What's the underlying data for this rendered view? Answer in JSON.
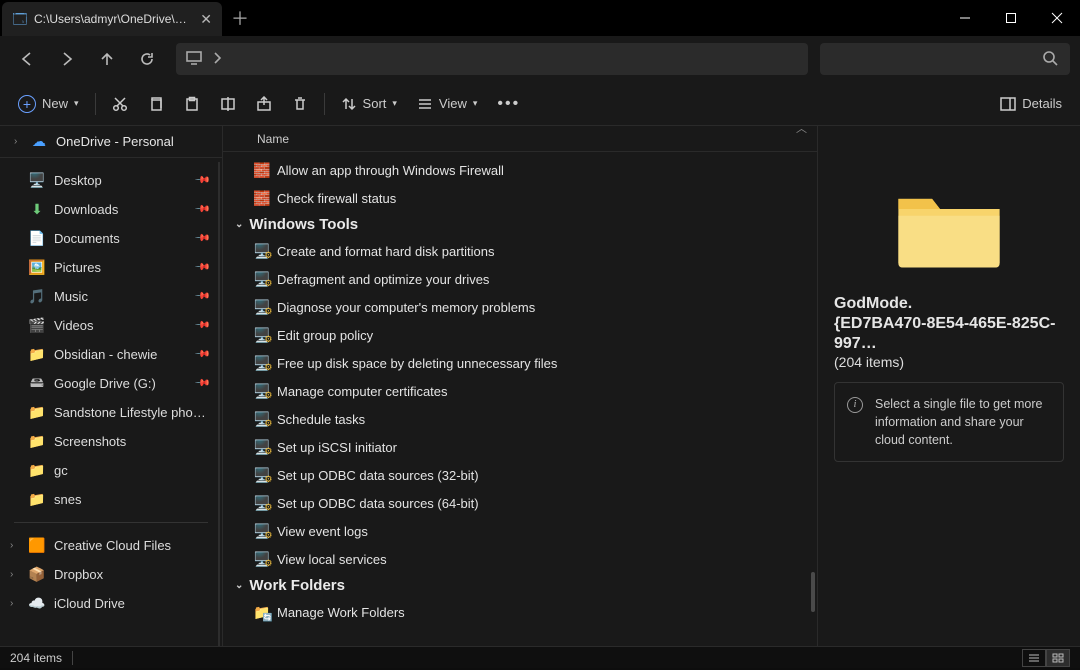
{
  "tab": {
    "title": "C:\\Users\\admyr\\OneDrive\\Des"
  },
  "toolbar": {
    "new": "New",
    "sort": "Sort",
    "view": "View",
    "details": "Details"
  },
  "onedrive_header": "OneDrive - Personal",
  "sidebar": [
    {
      "icon": "🖥️",
      "cls": "i-desktop",
      "label": "Desktop",
      "pinned": true
    },
    {
      "icon": "⬇",
      "cls": "i-download",
      "label": "Downloads",
      "pinned": true
    },
    {
      "icon": "📄",
      "cls": "i-doc",
      "label": "Documents",
      "pinned": true
    },
    {
      "icon": "🖼️",
      "cls": "i-pic",
      "label": "Pictures",
      "pinned": true
    },
    {
      "icon": "🎵",
      "cls": "i-music",
      "label": "Music",
      "pinned": true
    },
    {
      "icon": "🎬",
      "cls": "i-video",
      "label": "Videos",
      "pinned": true
    },
    {
      "icon": "📁",
      "cls": "i-folder",
      "label": "Obsidian - chewie",
      "pinned": true
    },
    {
      "icon": "🖴",
      "cls": "i-drive",
      "label": "Google Drive (G:)",
      "pinned": true
    },
    {
      "icon": "📁",
      "cls": "i-folder",
      "label": "Sandstone Lifestyle photos",
      "pinned": false
    },
    {
      "icon": "📁",
      "cls": "i-folder",
      "label": "Screenshots",
      "pinned": false
    },
    {
      "icon": "📁",
      "cls": "i-folder",
      "label": "gc",
      "pinned": false
    },
    {
      "icon": "📁",
      "cls": "i-folder",
      "label": "snes",
      "pinned": false
    }
  ],
  "sidebar_bottom": [
    {
      "icon": "🟧",
      "label": "Creative Cloud Files"
    },
    {
      "icon": "📦",
      "label": "Dropbox",
      "iconColor": "#2f7dff"
    },
    {
      "icon": "☁️",
      "label": "iCloud Drive",
      "iconColor": "#3fbcf5"
    }
  ],
  "header_col": "Name",
  "firewall_items": [
    "Allow an app through Windows Firewall",
    "Check firewall status"
  ],
  "groups": [
    {
      "title": "Windows Tools",
      "iconClass": "i-tool",
      "iconGlyph": "🖥️",
      "items": [
        "Create and format hard disk partitions",
        "Defragment and optimize your drives",
        "Diagnose your computer's memory problems",
        "Edit group policy",
        "Free up disk space by deleting unnecessary files",
        "Manage computer certificates",
        "Schedule tasks",
        "Set up iSCSI initiator",
        "Set up ODBC data sources (32-bit)",
        "Set up ODBC data sources (64-bit)",
        "View event logs",
        "View local services"
      ]
    },
    {
      "title": "Work Folders",
      "iconClass": "i-workfolder",
      "iconGlyph": "📁",
      "items": [
        "Manage Work Folders"
      ]
    }
  ],
  "details": {
    "name_line1": "GodMode.",
    "name_line2": "{ED7BA470-8E54-465E-825C-997…",
    "subtitle": "(204 items)",
    "tip": "Select a single file to get more information and share your cloud content."
  },
  "status": {
    "count": "204 items"
  }
}
